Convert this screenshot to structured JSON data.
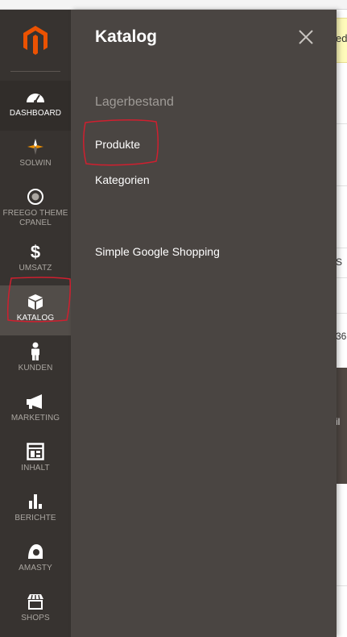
{
  "sidebar": {
    "logo": "magento-logo",
    "items": [
      {
        "label": "DASHBOARD",
        "icon": "dashboard-icon"
      },
      {
        "label": "SOLWIN",
        "icon": "solwin-icon"
      },
      {
        "label": "FREEGO THEME CPANEL",
        "icon": "target-icon"
      },
      {
        "label": "UMSATZ",
        "icon": "dollar-icon"
      },
      {
        "label": "KATALOG",
        "icon": "box-icon"
      },
      {
        "label": "KUNDEN",
        "icon": "person-icon"
      },
      {
        "label": "MARKETING",
        "icon": "megaphone-icon"
      },
      {
        "label": "INHALT",
        "icon": "layout-icon"
      },
      {
        "label": "BERICHTE",
        "icon": "bar-chart-icon"
      },
      {
        "label": "AMASTY",
        "icon": "amasty-icon"
      },
      {
        "label": "SHOPS",
        "icon": "store-icon"
      }
    ]
  },
  "flyout": {
    "title": "Katalog",
    "section_title": "Lagerbestand",
    "links": [
      "Produkte",
      "Kategorien",
      "Simple Google Shopping"
    ]
  },
  "background": {
    "notice_fragment": "ed",
    "cut_letter": "S",
    "cut_number": "36",
    "dark_cut": "il"
  },
  "colors": {
    "sidebar_bg": "#373330",
    "flyout_bg": "#4a4542",
    "accent": "#eb5202",
    "annotation": "#d01f2f"
  }
}
